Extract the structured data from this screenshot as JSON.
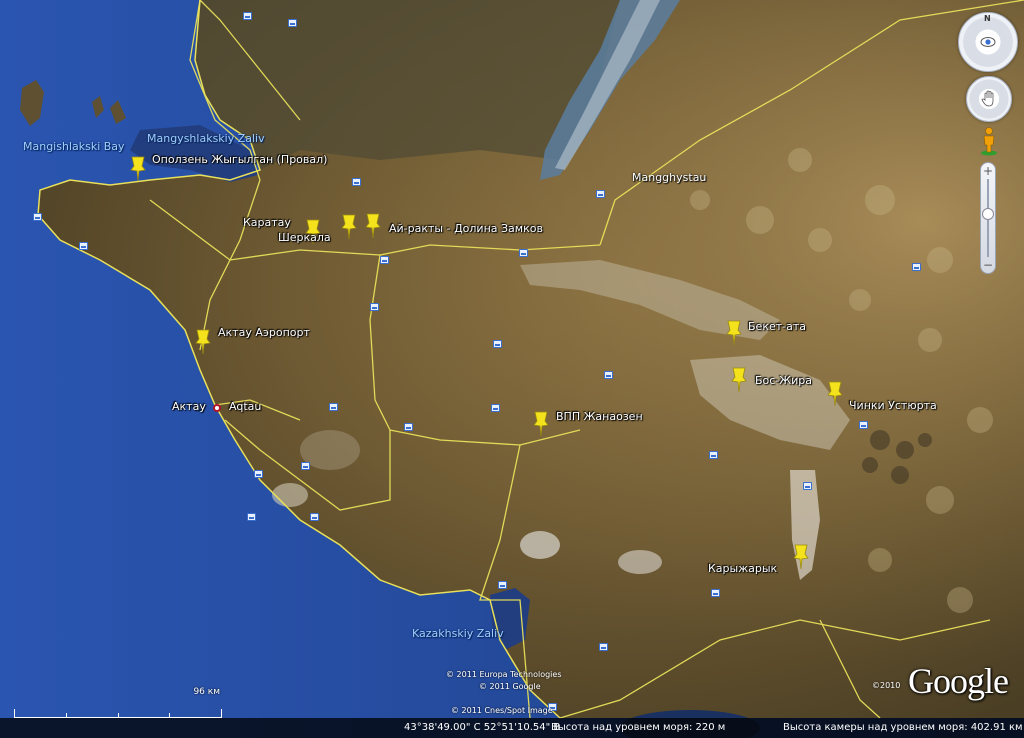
{
  "places": [
    {
      "label": "Оползень Жыгылган (Провал)"
    },
    {
      "label": "Каратау"
    },
    {
      "label": "Шеркала"
    },
    {
      "label": "Ай-ракты - Долина Замков"
    },
    {
      "label": "Актау Аэропорт"
    },
    {
      "label": "Актау"
    },
    {
      "label": "ВПП Жанаозен"
    },
    {
      "label": "Бекет-ата"
    },
    {
      "label": "Бос-Жира"
    },
    {
      "label": "Чинки Устюрта"
    },
    {
      "label": "Карыжарык"
    }
  ],
  "city": "Aqtau",
  "region": "Mangghystau",
  "water": [
    "Mangishlakski Bay",
    "Mangyshlakskiy Zaliv",
    "Kazakhskiy Zaliv"
  ],
  "credits": {
    "line1": "© 2011 Europa Technologies",
    "line2": "© 2011 Google",
    "line3": "© 2011 Cnes/Spot Image",
    "year_mark": "©2010"
  },
  "logo": "Google",
  "scale_label": "96 км",
  "status": {
    "coords": "43°38'49.00\" С   52°51'10.54\" В",
    "elevation": "Высота над уровнем моря:   220 м",
    "eye_alt": "Высота камеры над уровнем моря:   402.91 км"
  },
  "controls": {
    "north": "N",
    "zoom_in": "+",
    "zoom_out": "−"
  },
  "colors": {
    "sea": "#2a4fa0",
    "land": "#6b5a32",
    "roads": "#e8e05a",
    "pin": "#f4e21c"
  },
  "icons": [
    "pushpin-icon",
    "road-shield-icon",
    "eye-icon",
    "hand-icon",
    "pegman-icon"
  ]
}
